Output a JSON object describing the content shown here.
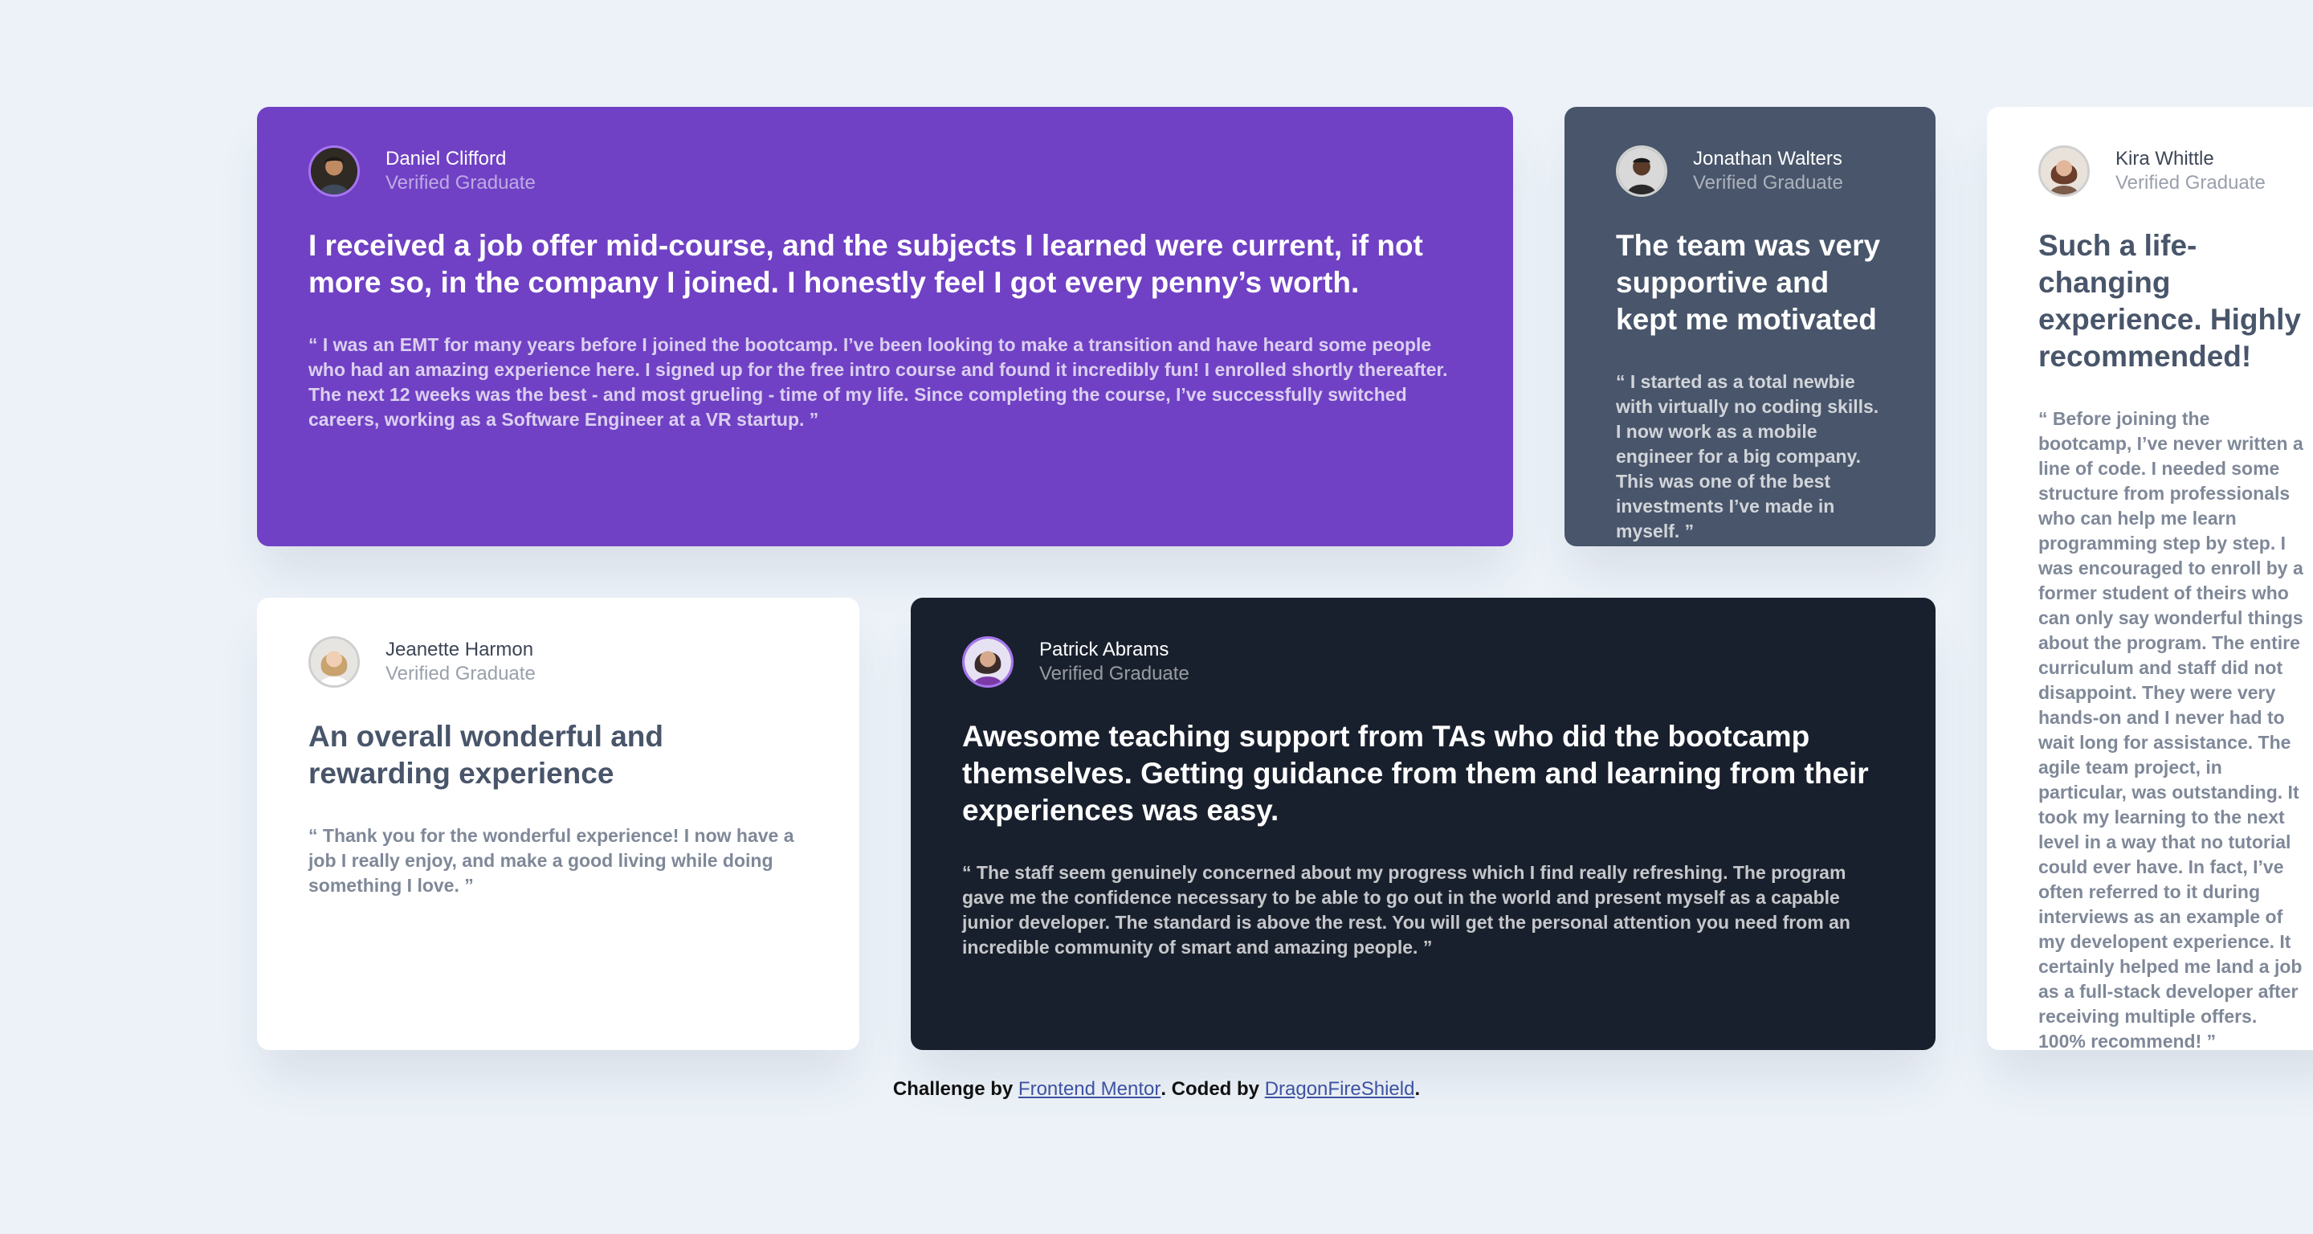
{
  "colors": {
    "background": "#ecf2f8",
    "purple": "#7041c4",
    "slate": "#48556a",
    "white": "#ffffff",
    "navy": "#19202d",
    "link": "#3e52a3"
  },
  "testimonials": [
    {
      "name": "Daniel Clifford",
      "role": "Verified Graduate",
      "title": "I received a job offer mid-course, and the subjects I learned were current, if not more so, in the company I joined. I honestly feel I got every penny’s worth.",
      "quote": "“ I was an EMT for many years before I joined the bootcamp. I’ve been looking to make a transition and have heard some people who had an amazing experience here. I signed up for the free intro course and found it incredibly fun! I enrolled shortly thereafter. The next 12 weeks was the best - and most grueling - time of my life. Since completing the course, I’ve successfully switched careers, working as a Software Engineer at a VR startup. ”",
      "avatar": "avatar-daniel"
    },
    {
      "name": "Jonathan Walters",
      "role": "Verified Graduate",
      "title": "The team was very supportive and kept me motivated",
      "quote": "“ I started as a total newbie with virtually no coding skills. I now work as a mobile engineer for a big company. This was one of the best investments I’ve made in myself. ”",
      "avatar": "avatar-jonathan"
    },
    {
      "name": "Kira Whittle",
      "role": "Verified Graduate",
      "title": "Such a life-changing experience. Highly recommended!",
      "quote": "“ Before joining the bootcamp, I’ve never written a line of code. I needed some structure from professionals who can help me learn programming step by step. I was encouraged to enroll by a former student of theirs who can only say wonderful things about the program. The entire curriculum and staff did not disappoint. They were very hands-on and I never had to wait long for assistance. The agile team project, in particular, was outstanding. It took my learning to the next level in a way that no tutorial could ever have. In fact, I’ve often referred to it during interviews as an example of my developent experience. It certainly helped me land a job as a full-stack developer after receiving multiple offers. 100% recommend! ”",
      "avatar": "avatar-kira"
    },
    {
      "name": "Jeanette Harmon",
      "role": "Verified Graduate",
      "title": "An overall wonderful and rewarding experience",
      "quote": "“ Thank you for the wonderful experience! I now have a job I really enjoy, and make a good living while doing something I love. ”",
      "avatar": "avatar-jeanette"
    },
    {
      "name": "Patrick Abrams",
      "role": "Verified Graduate",
      "title": "Awesome teaching support from TAs who did the bootcamp themselves. Getting guidance from them and learning from their experiences was easy.",
      "quote": "“ The staff seem genuinely concerned about my progress which I find really refreshing. The program gave me the confidence necessary to be able to go out in the world and present myself as a capable junior developer. The standard is above the rest. You will get the personal attention you need from an incredible community of smart and amazing people. ”",
      "avatar": "avatar-patrick"
    }
  ],
  "footer": {
    "prefix": "Challenge by ",
    "link1": "Frontend Mentor",
    "middle": ". Coded by ",
    "link2": "DragonFireShield",
    "suffix": "."
  }
}
